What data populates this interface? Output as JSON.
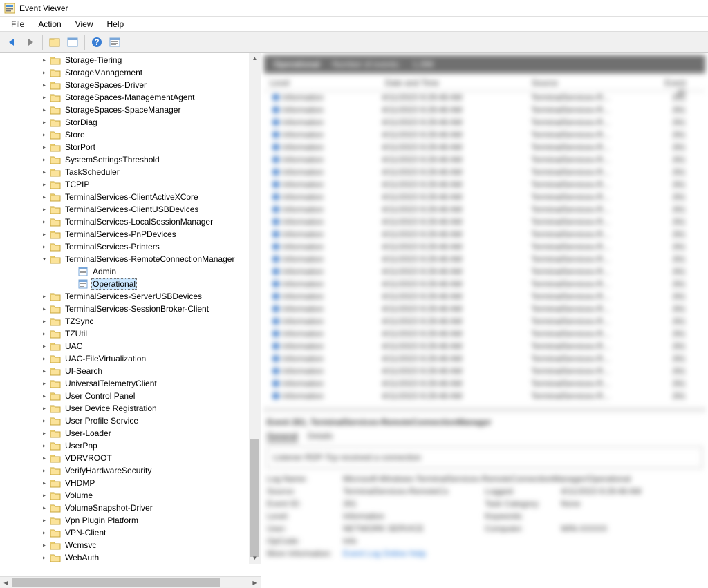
{
  "window": {
    "title": "Event Viewer"
  },
  "menu": {
    "file": "File",
    "action": "Action",
    "view": "View",
    "help": "Help"
  },
  "tree": {
    "nodes": [
      {
        "label": "Storage-Tiering",
        "type": "folder"
      },
      {
        "label": "StorageManagement",
        "type": "folder"
      },
      {
        "label": "StorageSpaces-Driver",
        "type": "folder"
      },
      {
        "label": "StorageSpaces-ManagementAgent",
        "type": "folder"
      },
      {
        "label": "StorageSpaces-SpaceManager",
        "type": "folder"
      },
      {
        "label": "StorDiag",
        "type": "folder"
      },
      {
        "label": "Store",
        "type": "folder"
      },
      {
        "label": "StorPort",
        "type": "folder"
      },
      {
        "label": "SystemSettingsThreshold",
        "type": "folder"
      },
      {
        "label": "TaskScheduler",
        "type": "folder"
      },
      {
        "label": "TCPIP",
        "type": "folder"
      },
      {
        "label": "TerminalServices-ClientActiveXCore",
        "type": "folder"
      },
      {
        "label": "TerminalServices-ClientUSBDevices",
        "type": "folder"
      },
      {
        "label": "TerminalServices-LocalSessionManager",
        "type": "folder"
      },
      {
        "label": "TerminalServices-PnPDevices",
        "type": "folder"
      },
      {
        "label": "TerminalServices-Printers",
        "type": "folder"
      },
      {
        "label": "TerminalServices-RemoteConnectionManager",
        "type": "folder",
        "expanded": true,
        "children": [
          {
            "label": "Admin",
            "type": "log"
          },
          {
            "label": "Operational",
            "type": "log",
            "selected": true
          }
        ]
      },
      {
        "label": "TerminalServices-ServerUSBDevices",
        "type": "folder"
      },
      {
        "label": "TerminalServices-SessionBroker-Client",
        "type": "folder"
      },
      {
        "label": "TZSync",
        "type": "folder"
      },
      {
        "label": "TZUtil",
        "type": "folder"
      },
      {
        "label": "UAC",
        "type": "folder"
      },
      {
        "label": "UAC-FileVirtualization",
        "type": "folder"
      },
      {
        "label": "UI-Search",
        "type": "folder"
      },
      {
        "label": "UniversalTelemetryClient",
        "type": "folder"
      },
      {
        "label": "User Control Panel",
        "type": "folder"
      },
      {
        "label": "User Device Registration",
        "type": "folder"
      },
      {
        "label": "User Profile Service",
        "type": "folder"
      },
      {
        "label": "User-Loader",
        "type": "folder"
      },
      {
        "label": "UserPnp",
        "type": "folder"
      },
      {
        "label": "VDRVROOT",
        "type": "folder"
      },
      {
        "label": "VerifyHardwareSecurity",
        "type": "folder"
      },
      {
        "label": "VHDMP",
        "type": "folder"
      },
      {
        "label": "Volume",
        "type": "folder"
      },
      {
        "label": "VolumeSnapshot-Driver",
        "type": "folder"
      },
      {
        "label": "Vpn Plugin Platform",
        "type": "folder"
      },
      {
        "label": "VPN-Client",
        "type": "folder"
      },
      {
        "label": "Wcmsvc",
        "type": "folder"
      },
      {
        "label": "WebAuth",
        "type": "folder"
      }
    ]
  },
  "details": {
    "header_log": "Operational",
    "header_count_label": "Number of events:",
    "header_count": "1,398",
    "cols": {
      "level": "Level",
      "datetime": "Date and Time",
      "source": "Source",
      "eventid": "Event ID"
    },
    "row": {
      "level": "Information",
      "datetime": "4/11/2023 9:29:48 AM",
      "source": "TerminalServices-R...",
      "eventid": "261"
    },
    "row_count": 25,
    "event_title": "Event 261, TerminalServices-RemoteConnectionManager",
    "tab_general": "General",
    "tab_details": "Details",
    "msg": "Listener RDP-Tcp received a connection",
    "fields": {
      "log_name_l": "Log Name:",
      "log_name_v": "Microsoft-Windows-TerminalServices-RemoteConnectionManager/Operational",
      "source_l": "Source:",
      "source_v": "TerminalServices-RemoteCo",
      "logged_l": "Logged:",
      "logged_v": "4/11/2023 9:29:48 AM",
      "eventid_l": "Event ID:",
      "eventid_v": "261",
      "task_l": "Task Category:",
      "task_v": "None",
      "level_l": "Level:",
      "level_v": "Information",
      "keywords_l": "Keywords:",
      "keywords_v": "",
      "user_l": "User:",
      "user_v": "NETWORK SERVICE",
      "computer_l": "Computer:",
      "computer_v": "WIN-XXXXX",
      "opcode_l": "OpCode:",
      "opcode_v": "Info",
      "moreinfo_l": "More Information:",
      "moreinfo_v": "Event Log Online Help"
    }
  }
}
